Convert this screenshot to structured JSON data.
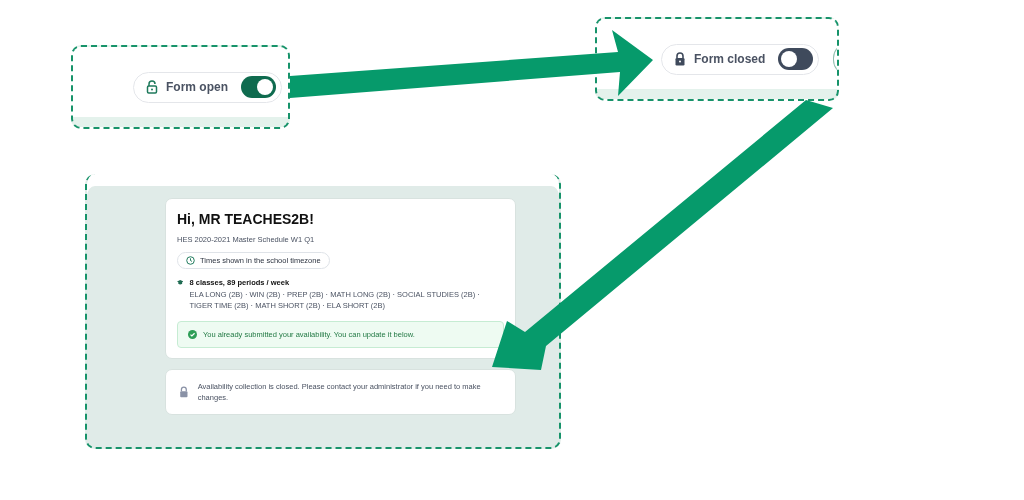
{
  "panels": [
    {
      "kind": "toggle",
      "toggle": {
        "label": "Form open",
        "on": true
      }
    },
    {
      "kind": "toggle",
      "toggle": {
        "label": "Form closed",
        "on": false
      }
    },
    {
      "kind": "page",
      "greeting": "Hi, MR TEACHES2B!",
      "schedule": "HES 2020-2021 Master Schedule W1 Q1",
      "timezone_note": "Times shown in the school timezone",
      "classes_summary": "8 classes, 89 periods / week",
      "classes_list": "ELA LONG (2B) · WIN (2B) · PREP (2B) · MATH LONG (2B) · SOCIAL STUDIES (2B) · TIGER TIME (2B) · MATH SHORT (2B) · ELA SHORT (2B)",
      "success_message": "You already submitted your availability. You can update it below.",
      "closed_notice": "Availability collection is closed. Please contact your administrator if you need to make changes."
    }
  ]
}
